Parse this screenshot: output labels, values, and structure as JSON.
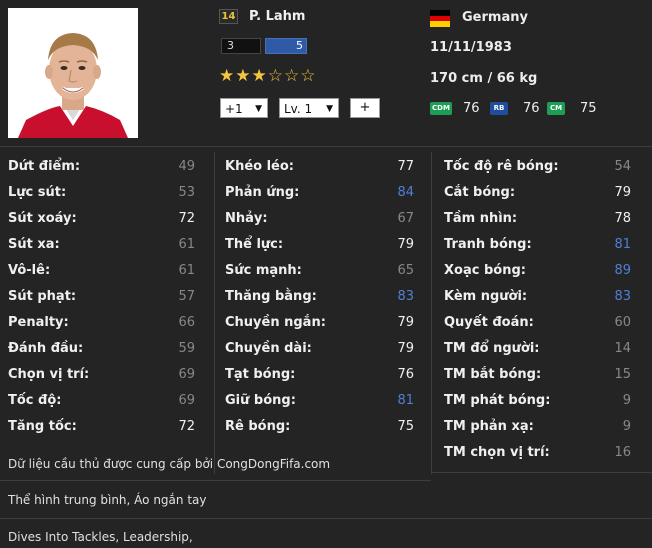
{
  "player": {
    "season_badge": "14",
    "name": "P. Lahm",
    "weak_foot": "3",
    "skill_moves": "5",
    "stars_filled": 3,
    "stars_total": 6,
    "upgrade_select": "+1",
    "level_select": "Lv. 1",
    "add_button": "+",
    "nation": "Germany",
    "birth_date": "11/11/1983",
    "height_weight": "170 cm / 66 kg",
    "flag_colors": [
      "#000000",
      "#dd0000",
      "#ffce00"
    ]
  },
  "positions": [
    {
      "code": "CDM",
      "rating": "76",
      "color": "#1e9e55"
    },
    {
      "code": "RB",
      "rating": "76",
      "color": "#1f4f9c"
    },
    {
      "code": "CM",
      "rating": "75",
      "color": "#1e9e55"
    }
  ],
  "stats": {
    "col1": [
      {
        "label": "Dứt điểm:",
        "value": "49",
        "tone": "gray"
      },
      {
        "label": "Lực sút:",
        "value": "53",
        "tone": "gray"
      },
      {
        "label": "Sút xoáy:",
        "value": "72",
        "tone": "white"
      },
      {
        "label": "Sút xa:",
        "value": "61",
        "tone": "gray"
      },
      {
        "label": "Vô-lê:",
        "value": "61",
        "tone": "gray"
      },
      {
        "label": "Sút phạt:",
        "value": "57",
        "tone": "gray"
      },
      {
        "label": "Penalty:",
        "value": "66",
        "tone": "gray"
      },
      {
        "label": "Đánh đầu:",
        "value": "59",
        "tone": "gray"
      },
      {
        "label": "Chọn vị trí:",
        "value": "69",
        "tone": "gray"
      },
      {
        "label": "Tốc độ:",
        "value": "69",
        "tone": "gray"
      },
      {
        "label": "Tăng tốc:",
        "value": "72",
        "tone": "white"
      }
    ],
    "col2": [
      {
        "label": "Khéo léo:",
        "value": "77",
        "tone": "white"
      },
      {
        "label": "Phản ứng:",
        "value": "84",
        "tone": "blue"
      },
      {
        "label": "Nhảy:",
        "value": "67",
        "tone": "gray"
      },
      {
        "label": "Thể lực:",
        "value": "79",
        "tone": "white"
      },
      {
        "label": "Sức mạnh:",
        "value": "65",
        "tone": "gray"
      },
      {
        "label": "Thăng bằng:",
        "value": "83",
        "tone": "blue"
      },
      {
        "label": "Chuyền ngắn:",
        "value": "79",
        "tone": "white"
      },
      {
        "label": "Chuyền dài:",
        "value": "79",
        "tone": "white"
      },
      {
        "label": "Tạt bóng:",
        "value": "76",
        "tone": "white"
      },
      {
        "label": "Giữ bóng:",
        "value": "81",
        "tone": "blue"
      },
      {
        "label": "Rê bóng:",
        "value": "75",
        "tone": "white"
      }
    ],
    "col3": [
      {
        "label": "Tốc độ rê bóng:",
        "value": "54",
        "tone": "gray"
      },
      {
        "label": "Cắt bóng:",
        "value": "79",
        "tone": "white"
      },
      {
        "label": "Tầm nhìn:",
        "value": "78",
        "tone": "white"
      },
      {
        "label": "Tranh bóng:",
        "value": "81",
        "tone": "blue"
      },
      {
        "label": "Xoạc bóng:",
        "value": "89",
        "tone": "blue"
      },
      {
        "label": "Kèm người:",
        "value": "83",
        "tone": "blue"
      },
      {
        "label": "Quyết đoán:",
        "value": "60",
        "tone": "gray"
      },
      {
        "label": "TM đổ người:",
        "value": "14",
        "tone": "gray"
      },
      {
        "label": "TM bắt bóng:",
        "value": "15",
        "tone": "gray"
      },
      {
        "label": "TM phát bóng:",
        "value": "9",
        "tone": "gray"
      },
      {
        "label": "TM phản xạ:",
        "value": "9",
        "tone": "gray"
      },
      {
        "label": "TM chọn vị trí:",
        "value": "16",
        "tone": "gray"
      }
    ]
  },
  "footer": {
    "source_prefix": "Dữ liệu cầu thủ được cung cấp bởi ",
    "source_link": "CongDongFifa.com",
    "body_info": "Thể hình trung bình, Áo ngắn tay",
    "traits": "Dives Into Tackles, Leadership,"
  }
}
